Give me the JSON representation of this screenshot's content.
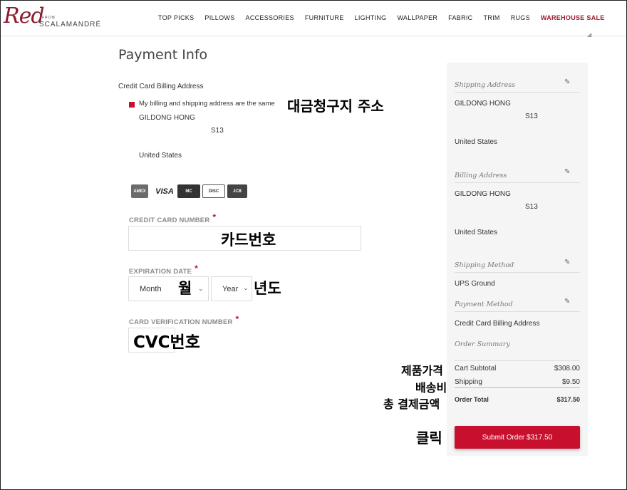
{
  "brand": {
    "script": "Red",
    "from": "FROM",
    "name": "SCALAMANDRÉ"
  },
  "nav": [
    "TOP PICKS",
    "PILLOWS",
    "ACCESSORIES",
    "FURNITURE",
    "LIGHTING",
    "WALLPAPER",
    "FABRIC",
    "TRIM",
    "RUGS",
    "WAREHOUSE SALE"
  ],
  "page_title": "Payment Info",
  "billing": {
    "heading": "Credit Card Billing Address",
    "same_label": "My billing and shipping address are the same",
    "same_checked": true,
    "name": "GILDONG HONG",
    "unit": "S13",
    "country": "United States"
  },
  "card_logos": [
    "AMEX",
    "VISA",
    "MasterCard",
    "DISCOVER",
    "JCB"
  ],
  "form": {
    "cc_label": "CREDIT CARD NUMBER",
    "exp_label": "EXPIRATION DATE",
    "month": "Month",
    "year": "Year",
    "cvv_label": "CARD VERIFICATION NUMBER",
    "required_mark": "*"
  },
  "annotations": {
    "billing_address": "대금청구지 주소",
    "card_number": "카드번호",
    "month": "월",
    "year": "년도",
    "cvc": "CVC번호",
    "product_price": "제품가격",
    "shipping_fee": "배송비",
    "total_payment": "총 결제금액",
    "click": "클릭"
  },
  "summary": {
    "shipping_address_head": "Shipping Address",
    "ship_name": "GILDONG HONG",
    "ship_unit": "S13",
    "ship_country": "United States",
    "billing_address_head": "Billing Address",
    "bill_name": "GILDONG HONG",
    "bill_unit": "S13",
    "bill_country": "United States",
    "shipping_method_head": "Shipping Method",
    "shipping_method": "UPS Ground",
    "payment_method_head": "Payment Method",
    "payment_method": "Credit Card Billing Address",
    "order_summary_head": "Order Summary",
    "subtotal_label": "Cart Subtotal",
    "subtotal_value": "$308.00",
    "shipping_label": "Shipping",
    "shipping_value": "$9.50",
    "total_label": "Order Total",
    "total_value": "$317.50",
    "submit_label": "Submit Order $317.50"
  },
  "colors": {
    "accent": "#c8102e",
    "brand": "#8b1d2c",
    "sidebar_bg": "#f5f5f5"
  }
}
